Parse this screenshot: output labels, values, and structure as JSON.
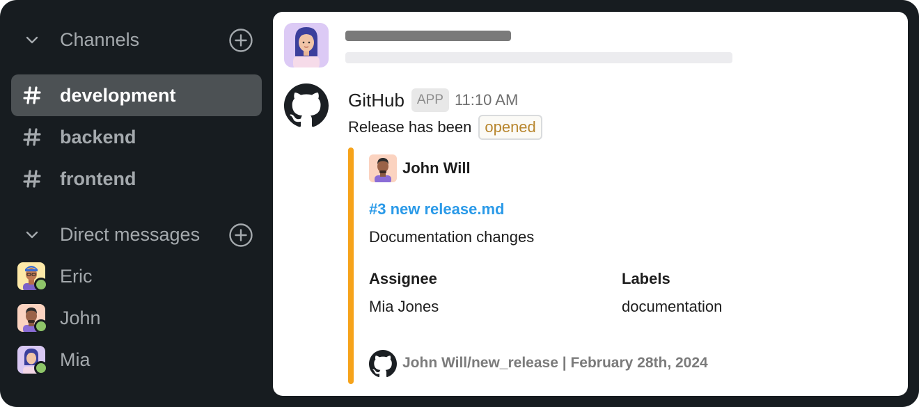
{
  "sidebar": {
    "channels_section": {
      "title": "Channels"
    },
    "channels": [
      {
        "label": "development",
        "active": true
      },
      {
        "label": "backend",
        "active": false
      },
      {
        "label": "frontend",
        "active": false
      }
    ],
    "dm_section": {
      "title": "Direct messages"
    },
    "direct_messages": [
      {
        "label": "Eric",
        "status": "online"
      },
      {
        "label": "John",
        "status": "online"
      },
      {
        "label": "Mia",
        "status": "online"
      }
    ]
  },
  "message": {
    "sender": "GitHub",
    "badge": "APP",
    "time": "11:10 AM",
    "text": "Release has been",
    "status_pill": "opened",
    "attachment": {
      "author": "John Will",
      "link": "#3 new release.md",
      "description": "Documentation changes",
      "fields": [
        {
          "title": "Assignee",
          "value": "Mia Jones"
        },
        {
          "title": "Labels",
          "value": "documentation"
        }
      ],
      "footer": "John Will/new_release | February 28th, 2024"
    }
  },
  "colors": {
    "sidebar_bg": "#171c20",
    "active_channel_bg": "#4c5154",
    "attachment_accent": "#f6a31a",
    "link": "#2b9ae8",
    "status_pill_text": "#b8862e",
    "presence_online": "#8ec569"
  },
  "icons": {
    "collapse": "chevron-down-icon",
    "add": "plus-circle-icon",
    "channel": "hash-icon",
    "app_avatar": "github-icon"
  }
}
